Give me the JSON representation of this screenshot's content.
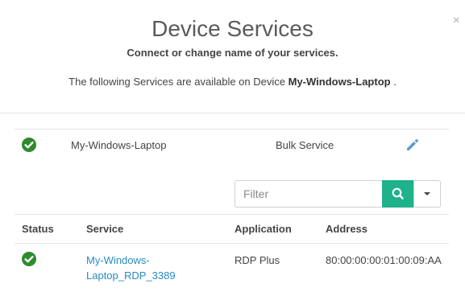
{
  "dialog": {
    "title": "Device Services",
    "subtitle": "Connect or change name of your services.",
    "info_prefix": "The following Services are available on Device",
    "device_name": "My-Windows-Laptop",
    "info_suffix": " ."
  },
  "device_row": {
    "name": "My-Windows-Laptop",
    "service_type": "Bulk Service",
    "status_icon": "check-circle-icon",
    "status_color": "#2e8b2e",
    "edit_icon": "pencil-icon",
    "edit_color": "#5b9bd5"
  },
  "filter": {
    "placeholder": "Filter",
    "search_icon": "search-icon",
    "button_color": "#1fb18a",
    "dropdown_icon": "caret-down-icon"
  },
  "table": {
    "headers": [
      "Status",
      "Service",
      "Application",
      "Address"
    ],
    "rows": [
      {
        "service_line1": "My-Windows-",
        "service_line2": "Laptop_RDP_3389",
        "application": "RDP Plus",
        "address": "80:00:00:00:01:00:09:AA"
      }
    ]
  }
}
